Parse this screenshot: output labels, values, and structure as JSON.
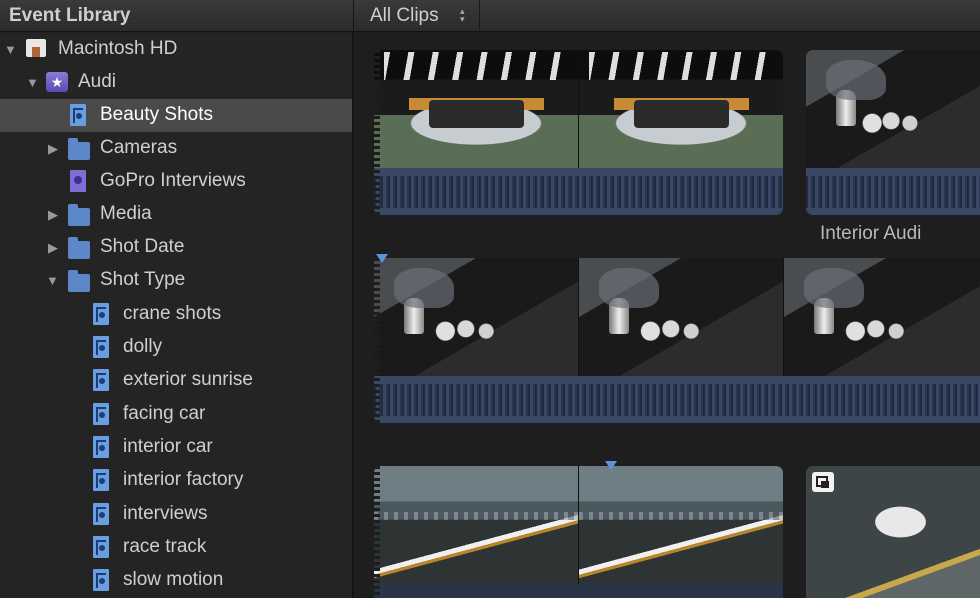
{
  "header": {
    "library_title": "Event Library",
    "clips_filter": "All Clips",
    "clips_arrows": "▲▼"
  },
  "sidebar": {
    "items": [
      {
        "label": "Macintosh HD",
        "icon": "hard-drive-icon",
        "expanded": true
      },
      {
        "label": "Audi",
        "icon": "event-star-icon",
        "expanded": true
      },
      {
        "label": "Beauty Shots",
        "icon": "smart-collection-icon",
        "selected": true
      },
      {
        "label": "Cameras",
        "icon": "folder-icon",
        "expanded": false
      },
      {
        "label": "GoPro Interviews",
        "icon": "keyword-collection-icon"
      },
      {
        "label": "Media",
        "icon": "folder-icon",
        "expanded": false
      },
      {
        "label": "Shot Date",
        "icon": "folder-icon",
        "expanded": false
      },
      {
        "label": "Shot Type",
        "icon": "folder-icon",
        "expanded": true
      },
      {
        "label": "crane shots",
        "icon": "smart-collection-icon"
      },
      {
        "label": "dolly",
        "icon": "smart-collection-icon"
      },
      {
        "label": "exterior sunrise",
        "icon": "smart-collection-icon"
      },
      {
        "label": "facing car",
        "icon": "smart-collection-icon"
      },
      {
        "label": "interior car",
        "icon": "smart-collection-icon"
      },
      {
        "label": "interior factory",
        "icon": "smart-collection-icon"
      },
      {
        "label": "interviews",
        "icon": "smart-collection-icon"
      },
      {
        "label": "race track",
        "icon": "smart-collection-icon"
      },
      {
        "label": "slow motion",
        "icon": "smart-collection-icon"
      }
    ]
  },
  "clips": {
    "interior_audi_label": "Interior Audi"
  },
  "colors": {
    "selection": "#4a4a4a",
    "folder": "#5c87c8",
    "audio_waveform": "#3a4866",
    "marker": "#5d93d8"
  }
}
